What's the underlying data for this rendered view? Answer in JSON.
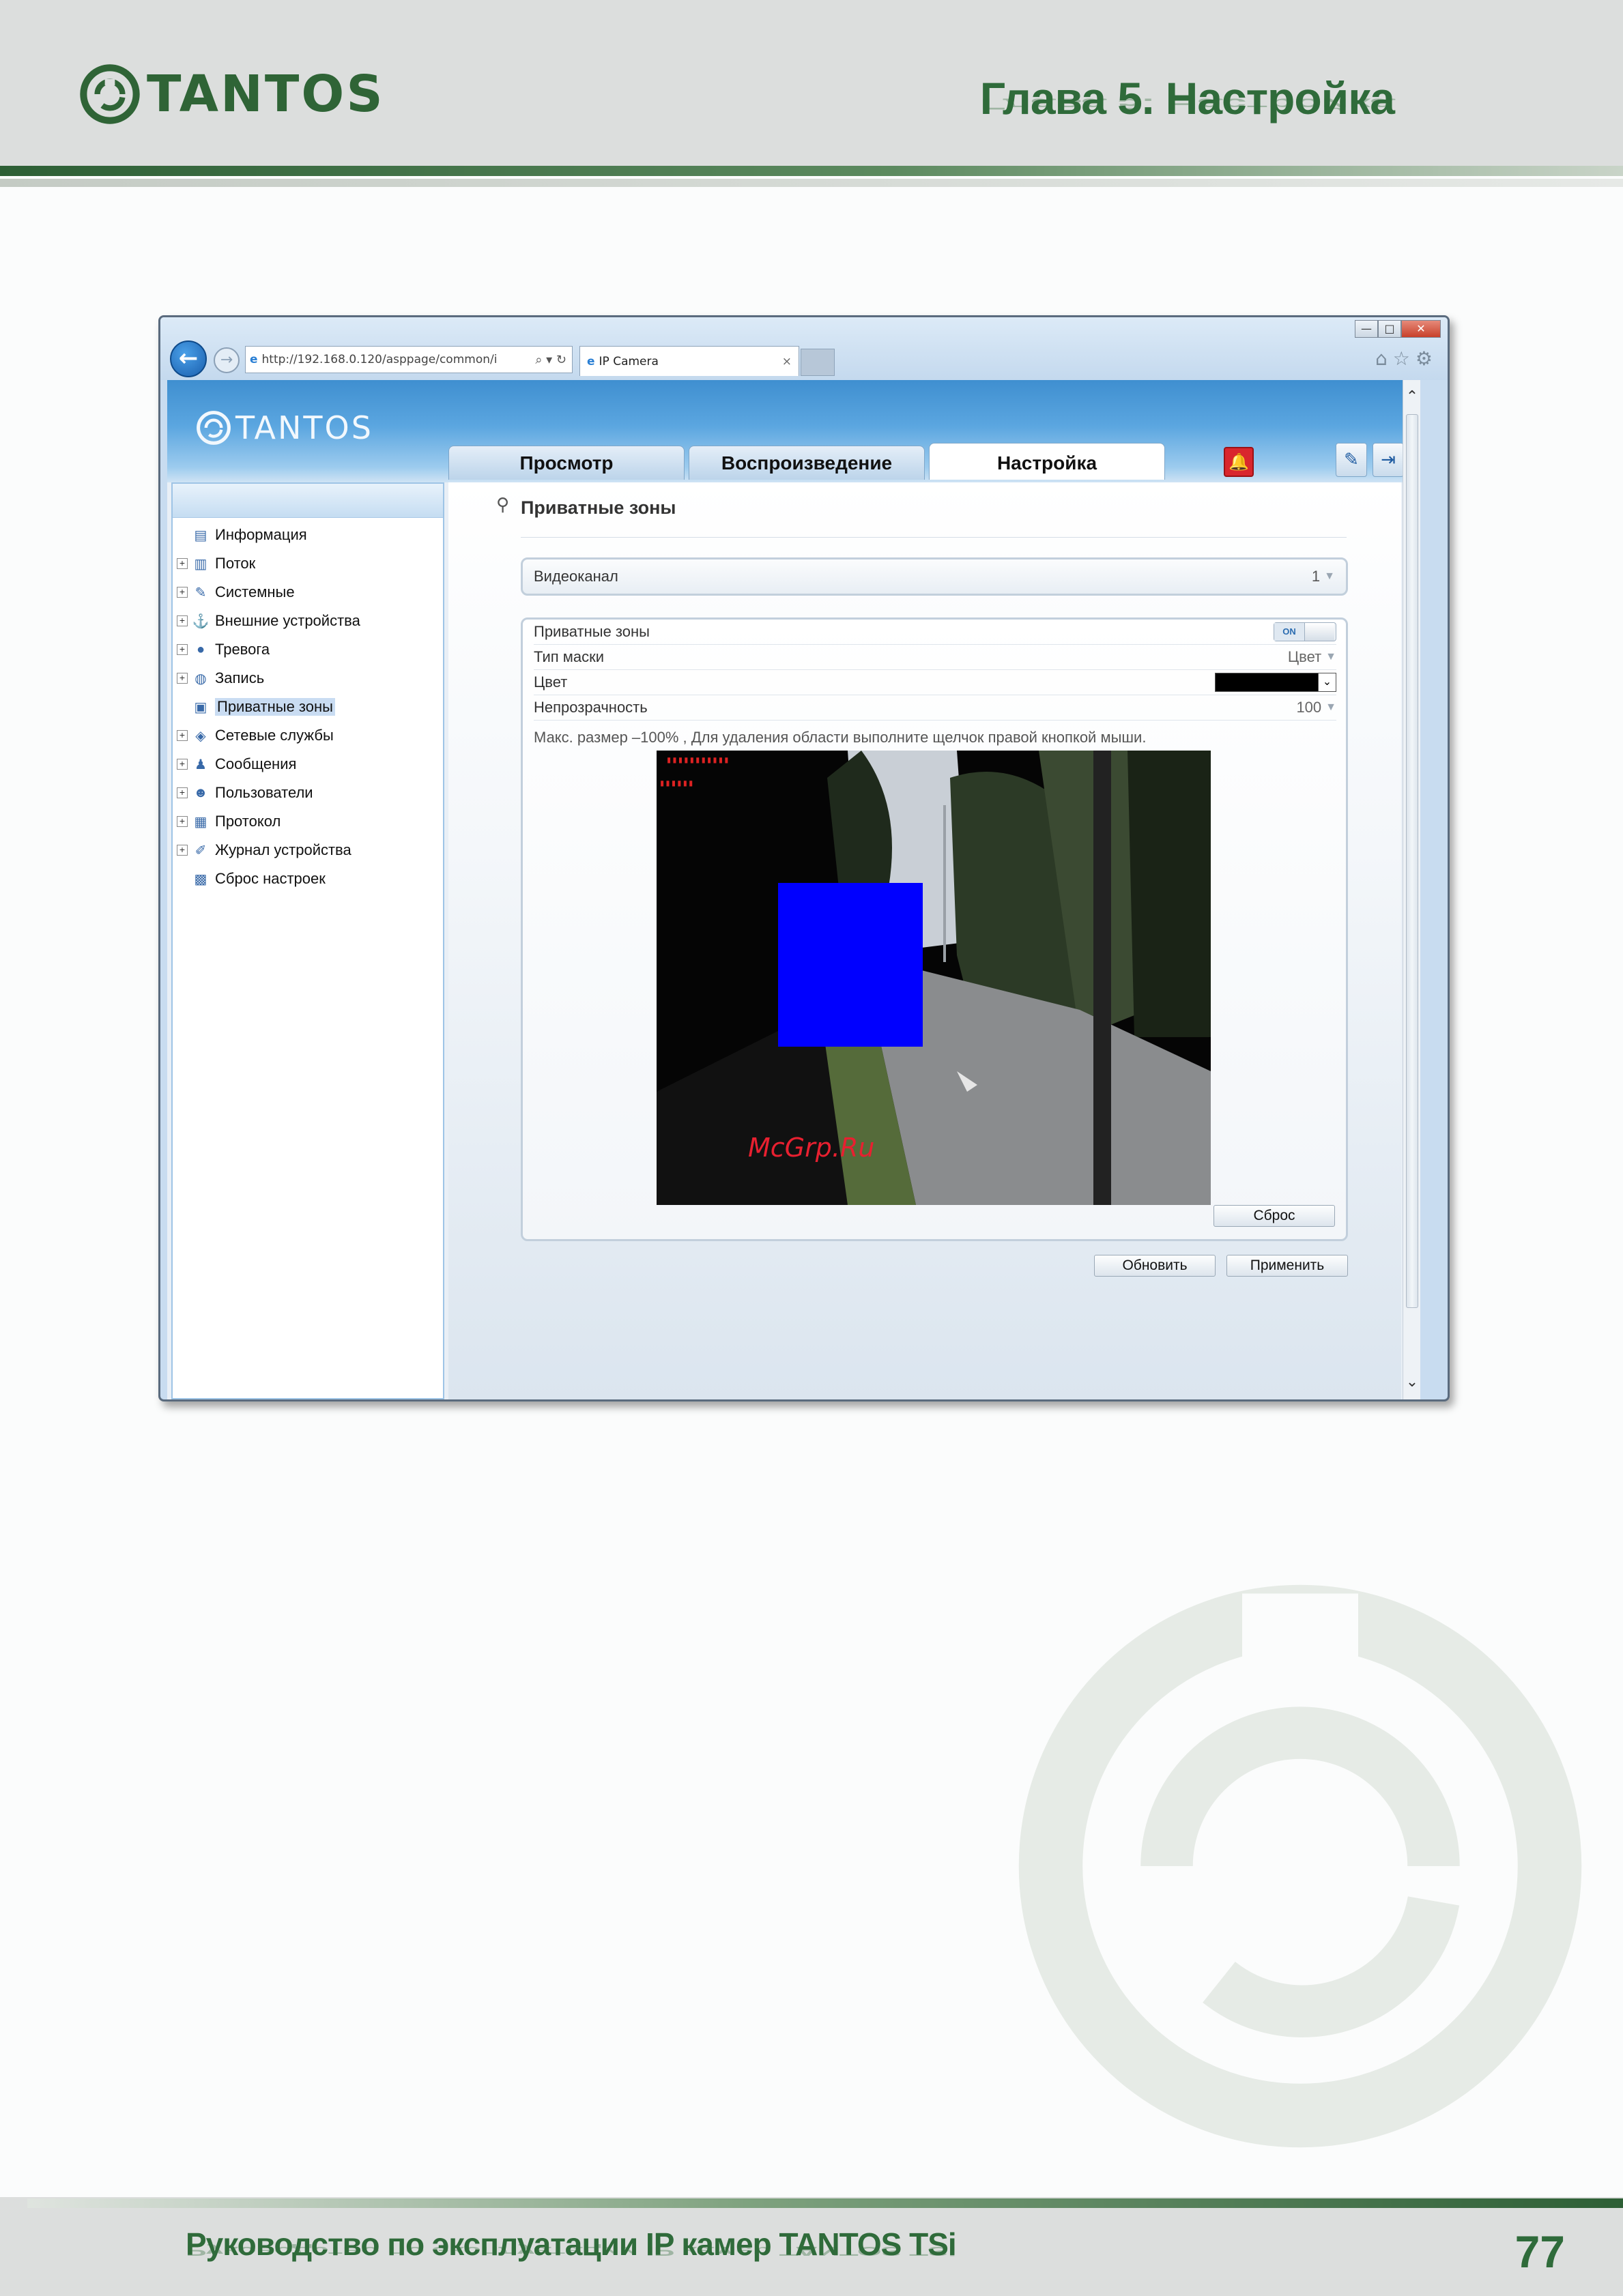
{
  "page": {
    "brand": "TANTOS",
    "chapter": "Глава 5. Настройка",
    "footer_title": "Руководство по эксплуатации IP камер TANTOS TSi",
    "page_number": "77"
  },
  "browser": {
    "url": "http://192.168.0.120/asppage/common/i",
    "tab_title": "IP Camera",
    "tab_close": "×",
    "controls": {
      "minimize": "—",
      "maximize": "□",
      "close": "✕"
    },
    "icons": [
      "home-icon",
      "star-icon",
      "gear-icon"
    ]
  },
  "app": {
    "logo": "TANTOS",
    "tabs": [
      {
        "label": "Просмотр",
        "active": false
      },
      {
        "label": "Воспроизведение",
        "active": false
      },
      {
        "label": "Настройка",
        "active": true
      }
    ],
    "sidebar": {
      "items": [
        {
          "label": "Информация",
          "icon": "info-icon",
          "expandable": false
        },
        {
          "label": "Поток",
          "icon": "stream-icon",
          "expandable": true
        },
        {
          "label": "Системные",
          "icon": "system-icon",
          "expandable": true
        },
        {
          "label": "Внешние устройства",
          "icon": "ptz-icon",
          "expandable": true
        },
        {
          "label": "Тревога",
          "icon": "alarm-icon",
          "expandable": true
        },
        {
          "label": "Запись",
          "icon": "record-icon",
          "expandable": true
        },
        {
          "label": "Приватные зоны",
          "icon": "privacy-icon",
          "expandable": false,
          "selected": true
        },
        {
          "label": "Сетевые службы",
          "icon": "network-icon",
          "expandable": true
        },
        {
          "label": "Сообщения",
          "icon": "message-icon",
          "expandable": true
        },
        {
          "label": "Пользователи",
          "icon": "users-icon",
          "expandable": true
        },
        {
          "label": "Протокол",
          "icon": "protocol-icon",
          "expandable": true
        },
        {
          "label": "Журнал устройства",
          "icon": "log-icon",
          "expandable": true
        },
        {
          "label": "Сброс настроек",
          "icon": "reset-icon",
          "expandable": false
        }
      ]
    },
    "content": {
      "section_title": "Приватные зоны",
      "channel": {
        "label": "Видеоканал",
        "value": "1"
      },
      "rows": {
        "privacy": {
          "label": "Приватные зоны",
          "toggle": "ON"
        },
        "mask_type": {
          "label": "Тип маски",
          "value": "Цвет"
        },
        "color": {
          "label": "Цвет",
          "value_color": "#000000"
        },
        "opacity": {
          "label": "Непрозрачность",
          "value": "100"
        }
      },
      "hint": "Макс. размер –100% , Для удаления области выполните щелчок правой кнопкой мыши.",
      "video": {
        "mask_color": "#0000ff",
        "watermark": "McGrp.Ru"
      },
      "buttons": {
        "reset": "Сброс",
        "refresh": "Обновить",
        "apply": "Применить"
      }
    }
  }
}
